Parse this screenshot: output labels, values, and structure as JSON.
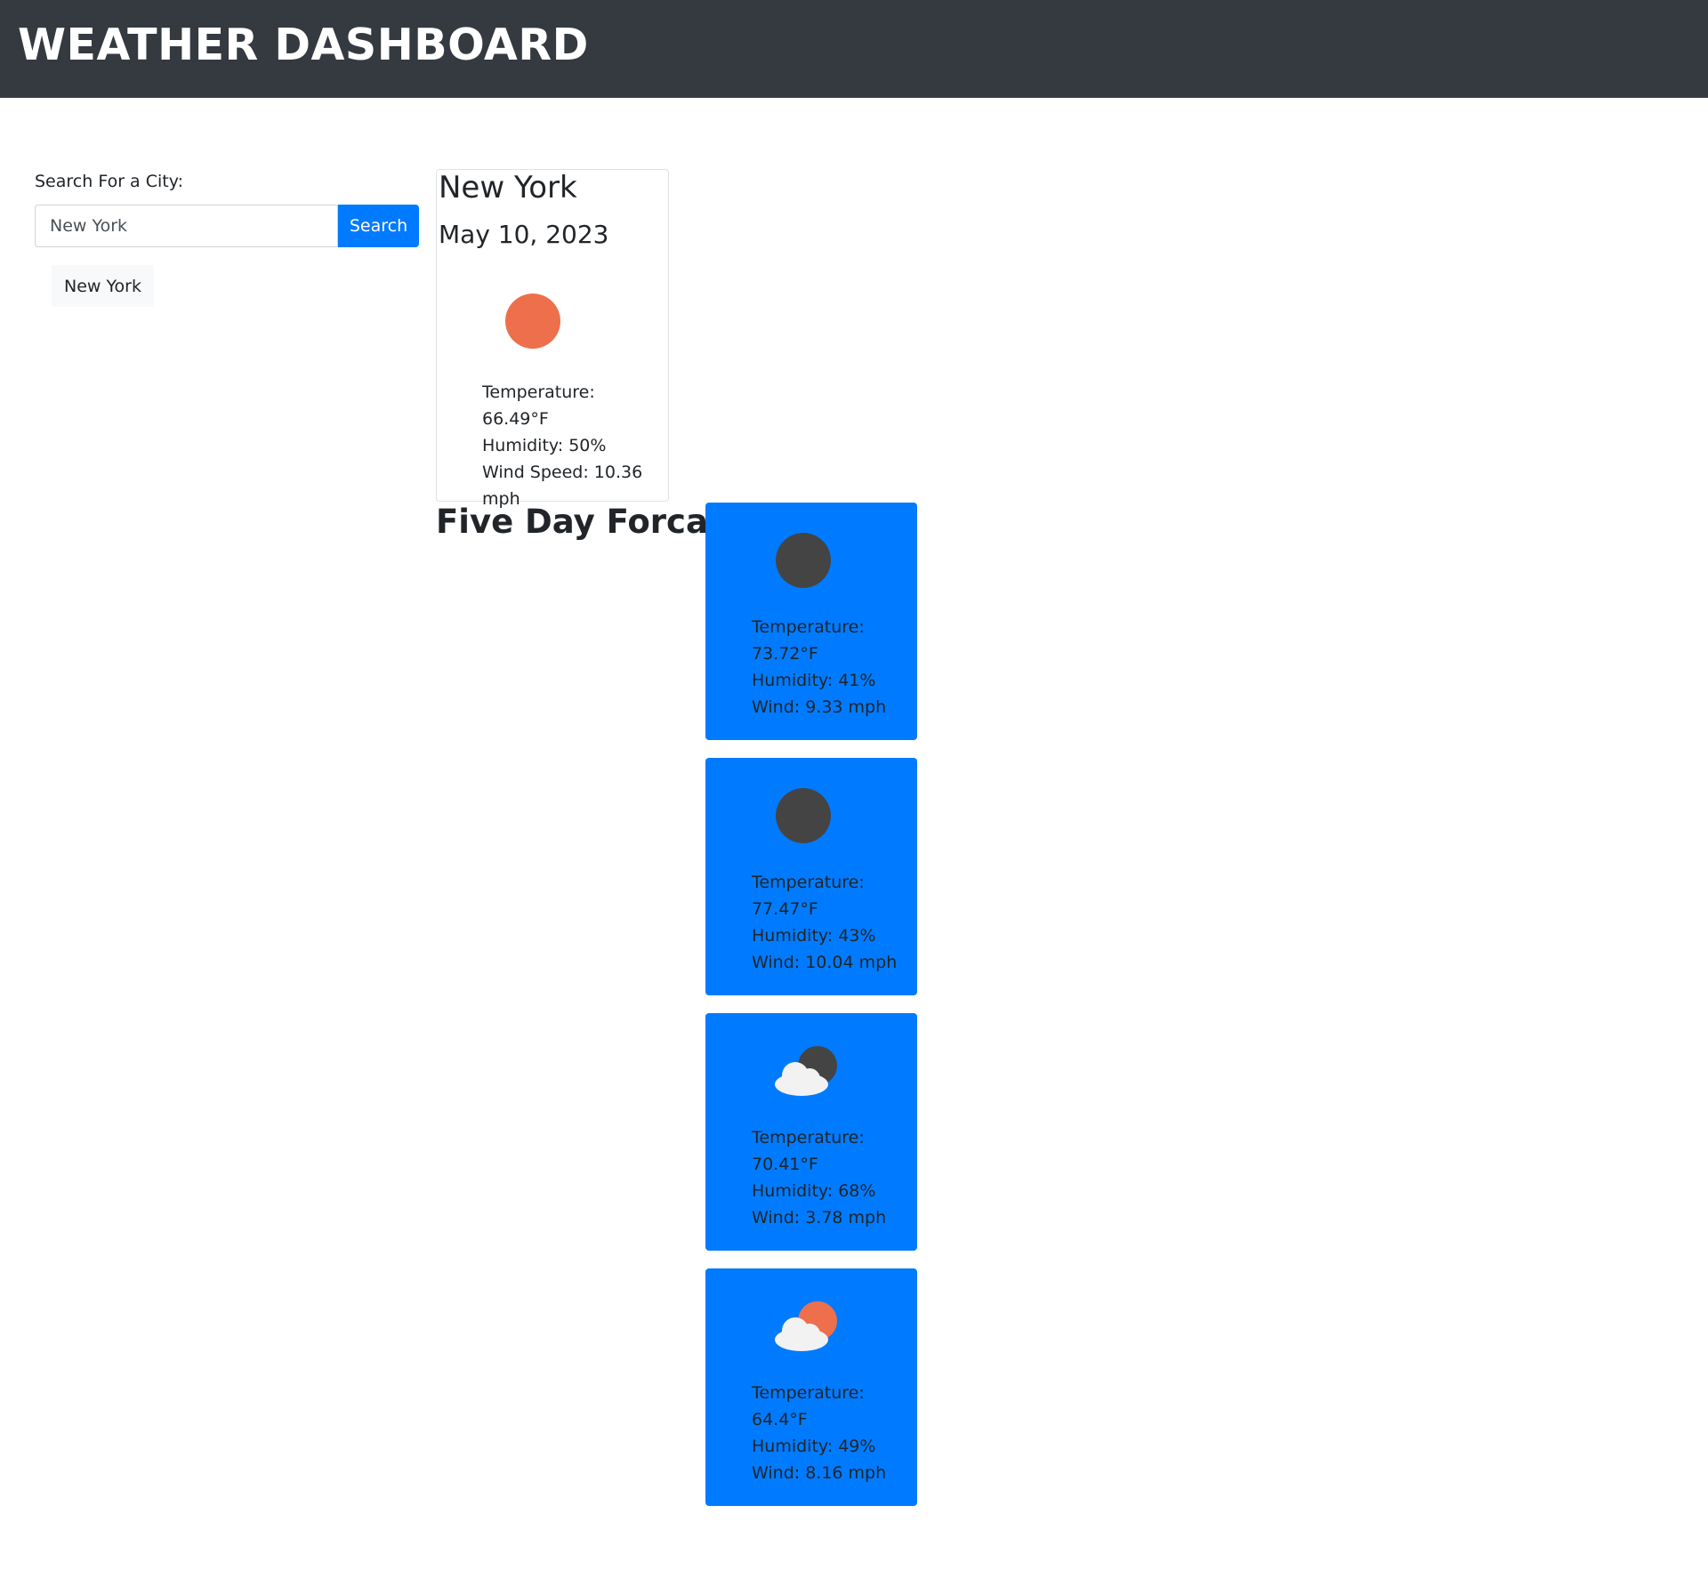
{
  "header": {
    "title": "WEATHER DASHBOARD"
  },
  "search": {
    "label": "Search For a City:",
    "value": "New York",
    "button_label": "Search",
    "history": [
      "New York"
    ]
  },
  "current": {
    "city": "New York",
    "date": "May 10, 2023",
    "icon": "sun-icon",
    "temperature": "Temperature: 66.49°F",
    "humidity": "Humidity: 50%",
    "wind": "Wind Speed: 10.36 mph"
  },
  "forecast": {
    "title": "Five Day Forcast:",
    "days": [
      {
        "icon": "moon-icon",
        "temperature_label": "Temperature:",
        "temperature": "73.72°F",
        "humidity": "Humidity: 41%",
        "wind": "Wind: 9.33 mph"
      },
      {
        "icon": "moon-icon",
        "temperature_label": "Temperature:",
        "temperature": "77.47°F",
        "humidity": "Humidity: 43%",
        "wind": "Wind: 10.04 mph"
      },
      {
        "icon": "cloud-moon-icon",
        "temperature_label": "Temperature:",
        "temperature": "70.41°F",
        "humidity": "Humidity: 68%",
        "wind": "Wind: 3.78 mph"
      },
      {
        "icon": "cloud-sun-icon",
        "temperature_label": "Temperature:",
        "temperature": "64.4°F",
        "humidity": "Humidity: 49%",
        "wind": "Wind: 8.16 mph"
      }
    ]
  },
  "colors": {
    "header_bg": "#343a40",
    "primary": "#007bff",
    "sun": "#ee6f4c",
    "moon": "#444444",
    "cloud": "#f2f2f2"
  }
}
